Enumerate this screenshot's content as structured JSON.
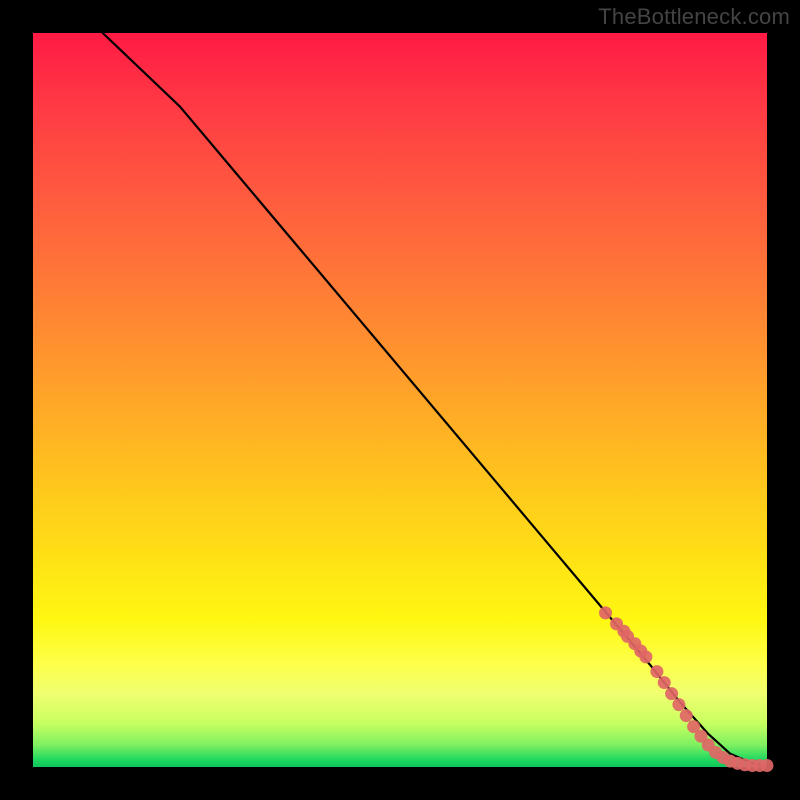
{
  "watermark": "TheBottleneck.com",
  "chart_data": {
    "type": "line",
    "title": "",
    "xlabel": "",
    "ylabel": "",
    "xlim": [
      0,
      100
    ],
    "ylim": [
      0,
      100
    ],
    "background_gradient": {
      "top_color": "#ff1a44",
      "bottom_color": "#0fc75a",
      "description": "vertical gradient red→orange→yellow→green"
    },
    "series": [
      {
        "name": "curve",
        "style": "line",
        "color": "#000000",
        "x": [
          9.5,
          20,
          28,
          36,
          44,
          52,
          60,
          68,
          76,
          84,
          88,
          92,
          95,
          98,
          100
        ],
        "y": [
          100,
          90,
          80.5,
          71,
          61.5,
          52,
          42.5,
          33,
          23.5,
          14,
          9,
          4.5,
          1.8,
          0.5,
          0.2
        ]
      },
      {
        "name": "points",
        "style": "scatter",
        "color": "#e06666",
        "x": [
          78,
          79.5,
          80.5,
          81,
          82,
          82.8,
          83.5,
          85,
          86,
          87,
          88,
          89,
          90,
          91,
          92,
          93,
          94,
          95,
          96,
          97,
          98,
          99,
          100
        ],
        "y": [
          21,
          19.5,
          18.5,
          17.8,
          16.8,
          15.8,
          15,
          13,
          11.5,
          10,
          8.5,
          7,
          5.5,
          4.2,
          3,
          2,
          1.3,
          0.8,
          0.5,
          0.3,
          0.2,
          0.2,
          0.2
        ]
      }
    ]
  }
}
